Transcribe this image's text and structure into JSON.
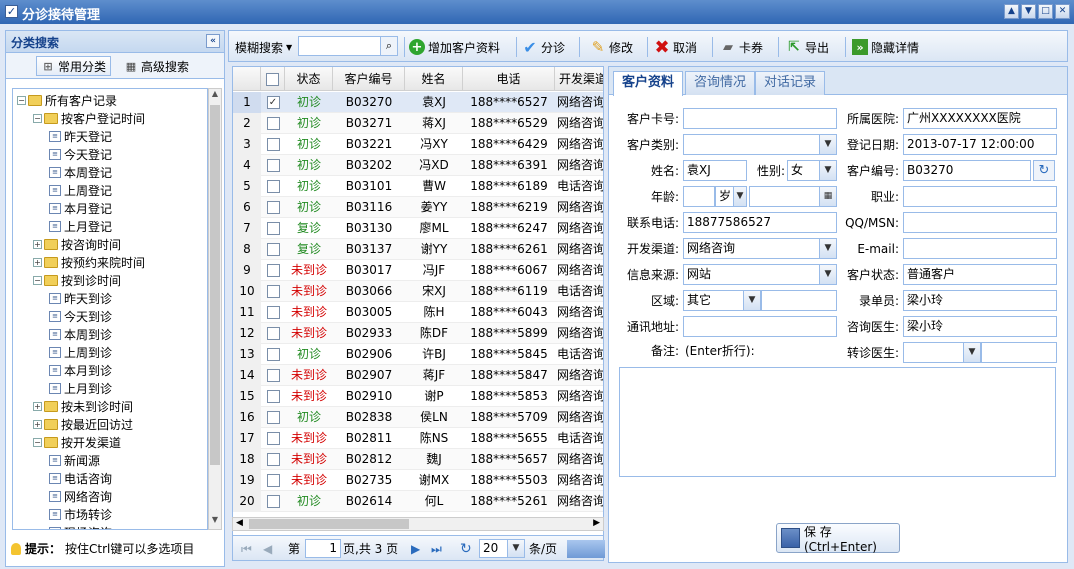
{
  "window": {
    "title": "分诊接待管理",
    "controls": [
      "▲",
      "▼",
      "□",
      "✕"
    ]
  },
  "left_panel": {
    "title": "分类搜索",
    "tabs": [
      {
        "label": "常用分类"
      },
      {
        "label": "高级搜索"
      }
    ],
    "tree": [
      {
        "label": "所有客户记录",
        "type": "folder",
        "level": 0,
        "toggle": "−"
      },
      {
        "label": "按客户登记时间",
        "type": "folder",
        "level": 1,
        "toggle": "−"
      },
      {
        "label": "昨天登记",
        "type": "leaf",
        "level": 2
      },
      {
        "label": "今天登记",
        "type": "leaf",
        "level": 2
      },
      {
        "label": "本周登记",
        "type": "leaf",
        "level": 2
      },
      {
        "label": "上周登记",
        "type": "leaf",
        "level": 2
      },
      {
        "label": "本月登记",
        "type": "leaf",
        "level": 2
      },
      {
        "label": "上月登记",
        "type": "leaf",
        "level": 2
      },
      {
        "label": "按咨询时间",
        "type": "folder",
        "level": 1,
        "toggle": "+"
      },
      {
        "label": "按预约来院时间",
        "type": "folder",
        "level": 1,
        "toggle": "+"
      },
      {
        "label": "按到诊时间",
        "type": "folder",
        "level": 1,
        "toggle": "−"
      },
      {
        "label": "昨天到诊",
        "type": "leaf",
        "level": 2
      },
      {
        "label": "今天到诊",
        "type": "leaf",
        "level": 2
      },
      {
        "label": "本周到诊",
        "type": "leaf",
        "level": 2
      },
      {
        "label": "上周到诊",
        "type": "leaf",
        "level": 2
      },
      {
        "label": "本月到诊",
        "type": "leaf",
        "level": 2
      },
      {
        "label": "上月到诊",
        "type": "leaf",
        "level": 2
      },
      {
        "label": "按未到诊时间",
        "type": "folder",
        "level": 1,
        "toggle": "+"
      },
      {
        "label": "按最近回访过",
        "type": "folder",
        "level": 1,
        "toggle": "+"
      },
      {
        "label": "按开发渠道",
        "type": "folder",
        "level": 1,
        "toggle": "−"
      },
      {
        "label": "新闻源",
        "type": "leaf",
        "level": 2
      },
      {
        "label": "电话咨询",
        "type": "leaf",
        "level": 2
      },
      {
        "label": "网络咨询",
        "type": "leaf",
        "level": 2
      },
      {
        "label": "市场转诊",
        "type": "leaf",
        "level": 2
      },
      {
        "label": "现场咨询",
        "type": "leaf",
        "level": 2
      }
    ],
    "tip_label": "提示：",
    "tip_text": "按住Ctrl键可以多选项目"
  },
  "toolbar": {
    "fuzzy_search": "模糊搜索",
    "search_value": "",
    "buttons": [
      {
        "label": "增加客户资料",
        "icon": "add-icon"
      },
      {
        "label": "分诊",
        "icon": "check-icon"
      },
      {
        "label": "修改",
        "icon": "pencil-icon"
      },
      {
        "label": "取消",
        "icon": "cancel-x-icon"
      },
      {
        "label": "卡券",
        "icon": "card-icon"
      },
      {
        "label": "导出",
        "icon": "export-icon"
      },
      {
        "label": "隐藏详情",
        "icon": "double-chevron-icon"
      }
    ]
  },
  "grid": {
    "columns": [
      "状态",
      "客户编号",
      "姓名",
      "电话",
      "开发渠道"
    ],
    "rows": [
      {
        "n": "1",
        "checked": true,
        "status": "初诊",
        "status_color": "green",
        "id": "B03270",
        "name": "袁XJ",
        "phone": "188****6527",
        "channel": "网络咨询"
      },
      {
        "n": "2",
        "checked": false,
        "status": "初诊",
        "status_color": "green",
        "id": "B03271",
        "name": "蒋XJ",
        "phone": "188****6529",
        "channel": "网络咨询"
      },
      {
        "n": "3",
        "checked": false,
        "status": "初诊",
        "status_color": "green",
        "id": "B03221",
        "name": "冯XY",
        "phone": "188****6429",
        "channel": "网络咨询"
      },
      {
        "n": "4",
        "checked": false,
        "status": "初诊",
        "status_color": "green",
        "id": "B03202",
        "name": "冯XD",
        "phone": "188****6391",
        "channel": "网络咨询"
      },
      {
        "n": "5",
        "checked": false,
        "status": "初诊",
        "status_color": "green",
        "id": "B03101",
        "name": "曹W",
        "phone": "188****6189",
        "channel": "电话咨询"
      },
      {
        "n": "6",
        "checked": false,
        "status": "初诊",
        "status_color": "green",
        "id": "B03116",
        "name": "姜YY",
        "phone": "188****6219",
        "channel": "网络咨询"
      },
      {
        "n": "7",
        "checked": false,
        "status": "复诊",
        "status_color": "green",
        "id": "B03130",
        "name": "廖ML",
        "phone": "188****6247",
        "channel": "网络咨询"
      },
      {
        "n": "8",
        "checked": false,
        "status": "复诊",
        "status_color": "green",
        "id": "B03137",
        "name": "谢YY",
        "phone": "188****6261",
        "channel": "网络咨询"
      },
      {
        "n": "9",
        "checked": false,
        "status": "未到诊",
        "status_color": "red",
        "id": "B03017",
        "name": "冯JF",
        "phone": "188****6067",
        "channel": "网络咨询"
      },
      {
        "n": "10",
        "checked": false,
        "status": "未到诊",
        "status_color": "red",
        "id": "B03066",
        "name": "宋XJ",
        "phone": "188****6119",
        "channel": "电话咨询"
      },
      {
        "n": "11",
        "checked": false,
        "status": "未到诊",
        "status_color": "red",
        "id": "B03005",
        "name": "陈H",
        "phone": "188****6043",
        "channel": "网络咨询"
      },
      {
        "n": "12",
        "checked": false,
        "status": "未到诊",
        "status_color": "red",
        "id": "B02933",
        "name": "陈DF",
        "phone": "188****5899",
        "channel": "网络咨询"
      },
      {
        "n": "13",
        "checked": false,
        "status": "初诊",
        "status_color": "green",
        "id": "B02906",
        "name": "许BJ",
        "phone": "188****5845",
        "channel": "电话咨询"
      },
      {
        "n": "14",
        "checked": false,
        "status": "未到诊",
        "status_color": "red",
        "id": "B02907",
        "name": "蒋JF",
        "phone": "188****5847",
        "channel": "网络咨询"
      },
      {
        "n": "15",
        "checked": false,
        "status": "未到诊",
        "status_color": "red",
        "id": "B02910",
        "name": "谢P",
        "phone": "188****5853",
        "channel": "网络咨询"
      },
      {
        "n": "16",
        "checked": false,
        "status": "初诊",
        "status_color": "green",
        "id": "B02838",
        "name": "侯LN",
        "phone": "188****5709",
        "channel": "网络咨询"
      },
      {
        "n": "17",
        "checked": false,
        "status": "未到诊",
        "status_color": "red",
        "id": "B02811",
        "name": "陈NS",
        "phone": "188****5655",
        "channel": "电话咨询"
      },
      {
        "n": "18",
        "checked": false,
        "status": "未到诊",
        "status_color": "red",
        "id": "B02812",
        "name": "魏J",
        "phone": "188****5657",
        "channel": "网络咨询"
      },
      {
        "n": "19",
        "checked": false,
        "status": "未到诊",
        "status_color": "red",
        "id": "B02735",
        "name": "谢MX",
        "phone": "188****5503",
        "channel": "网络咨询"
      },
      {
        "n": "20",
        "checked": false,
        "status": "初诊",
        "status_color": "green",
        "id": "B02614",
        "name": "何L",
        "phone": "188****5261",
        "channel": "网络咨询"
      }
    ]
  },
  "pager": {
    "page_prefix": "第",
    "page": "1",
    "page_suffix": "页,共 3 页",
    "page_size": "20",
    "size_suffix": "条/页"
  },
  "detail": {
    "tabs": [
      "客户资料",
      "咨询情况",
      "对话记录"
    ],
    "labels": {
      "card": "客户卡号:",
      "hospital": "所属医院:",
      "type": "客户类别:",
      "reg_date": "登记日期:",
      "name": "姓名:",
      "gender": "性别:",
      "cust_no": "客户编号:",
      "age": "年龄:",
      "age_unit": "岁",
      "job": "职业:",
      "phone": "联系电话:",
      "qq": "QQ/MSN:",
      "channel": "开发渠道:",
      "email": "E-mail:",
      "source": "信息来源:",
      "status": "客户状态:",
      "region": "区域:",
      "recorder": "录单员:",
      "address": "通讯地址:",
      "doctor": "咨询医生:",
      "remark": "备注:",
      "remark_hint": "(Enter折行):",
      "transfer": "转诊医生:"
    },
    "values": {
      "card": "",
      "hospital": "广州XXXXXXXX医院",
      "type": "",
      "reg_date": "2013-07-17 12:00:00",
      "name": "袁XJ",
      "gender": "女",
      "cust_no": "B03270",
      "age": "",
      "birthday": "",
      "job": "",
      "phone": "18877586527",
      "qq": "",
      "channel": "网络咨询",
      "email": "",
      "source": "网站",
      "status": "普通客户",
      "region": "其它",
      "region_extra": "",
      "recorder": "梁小玲",
      "address": "",
      "doctor": "梁小玲",
      "transfer": "",
      "transfer_extra": "",
      "remark": ""
    },
    "save_label": "保 存(Ctrl+Enter)"
  }
}
